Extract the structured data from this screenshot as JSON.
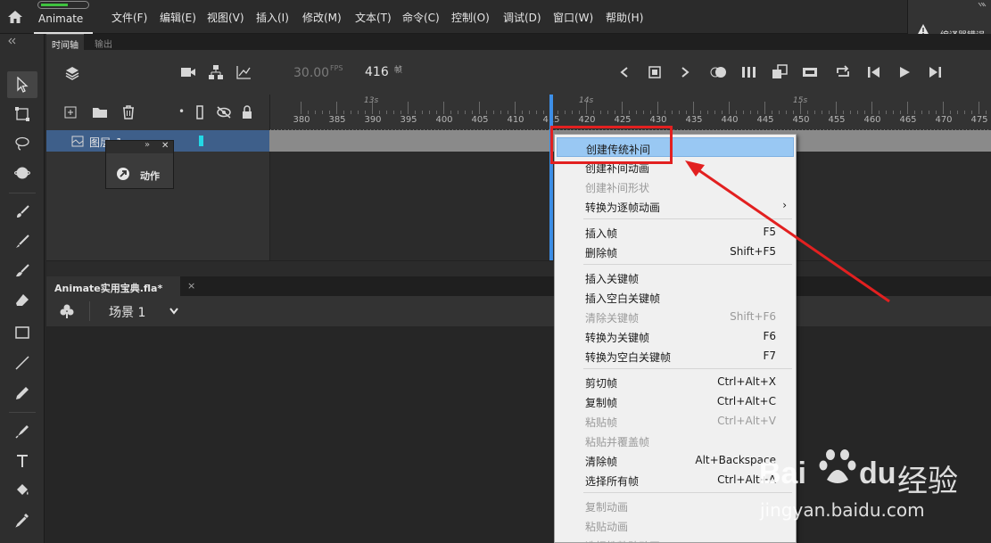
{
  "app": {
    "name": "Animate"
  },
  "menubar": {
    "items": [
      "文件(F)",
      "编辑(E)",
      "视图(V)",
      "插入(I)",
      "修改(M)",
      "文本(T)",
      "命令(C)",
      "控制(O)",
      "调试(D)",
      "窗口(W)",
      "帮助(H)"
    ]
  },
  "error_panel": {
    "label": "编译器错误"
  },
  "timeline": {
    "tabs": {
      "timeline": "时间轴",
      "output": "输出"
    },
    "fps": "30.00",
    "fps_unit": "FPS",
    "current_frame": "416",
    "frame_unit": "帧",
    "ruler": {
      "ticks": [
        "380",
        "385",
        "390",
        "395",
        "400",
        "405",
        "410",
        "415",
        "420",
        "425",
        "430",
        "435",
        "440",
        "445",
        "450",
        "455",
        "460",
        "465",
        "470",
        "475"
      ],
      "seconds": [
        "13s",
        "14s",
        "15s"
      ]
    },
    "layer": {
      "name": "图层_1"
    }
  },
  "actions_panel": {
    "label": "动作"
  },
  "document": {
    "tab_title": "Animate实用宝典.fla*",
    "tab_close": "×",
    "scene": "场景 1"
  },
  "context_menu": {
    "groups": [
      [
        {
          "label": "创建传统补间",
          "shortcut": "",
          "disabled": false,
          "highlighted": true
        },
        {
          "label": "创建补间动画",
          "shortcut": "",
          "disabled": false
        },
        {
          "label": "创建补间形状",
          "shortcut": "",
          "disabled": true
        },
        {
          "label": "转换为逐帧动画",
          "shortcut": "",
          "disabled": false,
          "submenu": true
        }
      ],
      [
        {
          "label": "插入帧",
          "shortcut": "F5",
          "disabled": false
        },
        {
          "label": "删除帧",
          "shortcut": "Shift+F5",
          "disabled": false
        }
      ],
      [
        {
          "label": "插入关键帧",
          "shortcut": "",
          "disabled": false
        },
        {
          "label": "插入空白关键帧",
          "shortcut": "",
          "disabled": false
        },
        {
          "label": "清除关键帧",
          "shortcut": "Shift+F6",
          "disabled": true
        },
        {
          "label": "转换为关键帧",
          "shortcut": "F6",
          "disabled": false
        },
        {
          "label": "转换为空白关键帧",
          "shortcut": "F7",
          "disabled": false
        }
      ],
      [
        {
          "label": "剪切帧",
          "shortcut": "Ctrl+Alt+X",
          "disabled": false
        },
        {
          "label": "复制帧",
          "shortcut": "Ctrl+Alt+C",
          "disabled": false
        },
        {
          "label": "粘贴帧",
          "shortcut": "Ctrl+Alt+V",
          "disabled": true
        },
        {
          "label": "粘贴并覆盖帧",
          "shortcut": "",
          "disabled": true
        },
        {
          "label": "清除帧",
          "shortcut": "Alt+Backspace",
          "disabled": false
        },
        {
          "label": "选择所有帧",
          "shortcut": "Ctrl+Alt+A",
          "disabled": false
        }
      ],
      [
        {
          "label": "复制动画",
          "shortcut": "",
          "disabled": true
        },
        {
          "label": "粘贴动画",
          "shortcut": "",
          "disabled": true
        },
        {
          "label": "选择性粘贴动画",
          "shortcut": "",
          "disabled": true
        }
      ]
    ]
  },
  "watermark": {
    "brand": "Bai",
    "brand2": "du",
    "product": "经验",
    "url": "jingyan.baidu.com"
  },
  "colors": {
    "highlight": "#99c8f3",
    "annotation": "#e22020",
    "layer_selected": "#3e5f8a",
    "playhead": "#3d8fe8"
  }
}
